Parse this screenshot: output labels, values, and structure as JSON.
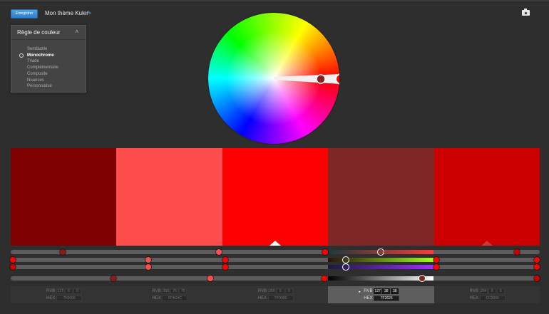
{
  "header": {
    "save_label": "Enregistrer",
    "theme_name": "Mon thème Kuler",
    "edit_icon": "pencil-icon",
    "capture_icon": "camera-icon"
  },
  "rule_panel": {
    "title": "Règle de couleur",
    "collapse_icon": "chevron-up-icon",
    "items": [
      {
        "label": "Semblable",
        "selected": false
      },
      {
        "label": "Monochrome",
        "selected": true
      },
      {
        "label": "Triade",
        "selected": false
      },
      {
        "label": "Complémentaire",
        "selected": false
      },
      {
        "label": "Composite",
        "selected": false
      },
      {
        "label": "Nuances",
        "selected": false
      },
      {
        "label": "Personnalisé",
        "selected": false
      }
    ]
  },
  "swatches": [
    {
      "hex": "#7F0000",
      "rvb": [
        "127",
        "0",
        "0"
      ],
      "hex_label": "7F0000",
      "active": false
    },
    {
      "hex": "#FF4C4C",
      "rvb": [
        "255",
        "76",
        "76"
      ],
      "hex_label": "FF4C4C",
      "active": false
    },
    {
      "hex": "#FF0000",
      "rvb": [
        "255",
        "0",
        "0"
      ],
      "hex_label": "FF0000",
      "active": false
    },
    {
      "hex": "#7F2626",
      "rvb": [
        "127",
        "38",
        "38"
      ],
      "hex_label": "7F2626",
      "active": true
    },
    {
      "hex": "#CC0000",
      "rvb": [
        "204",
        "0",
        "0"
      ],
      "hex_label": "CC0000",
      "active": false
    }
  ],
  "value_labels": {
    "rvb": "RVB",
    "hex": "HEX"
  },
  "colors": {
    "accent": "#3a8fd6",
    "background": "#2e2e2e"
  }
}
